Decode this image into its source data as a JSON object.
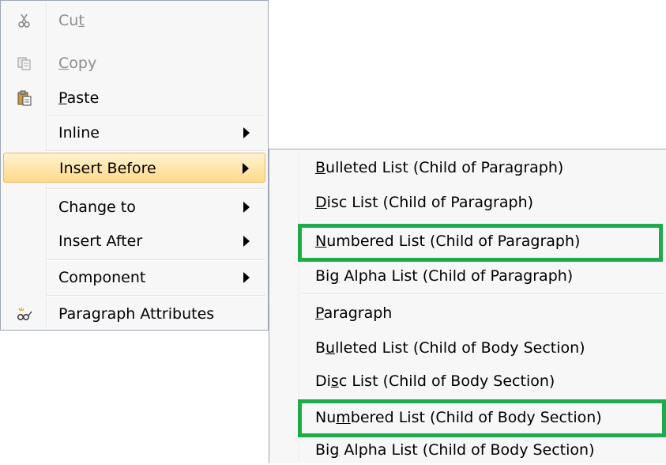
{
  "main_menu": {
    "items": [
      {
        "pre": "Cu",
        "acc": "t",
        "post": "",
        "icon": "scissors-icon"
      },
      {
        "pre": "",
        "acc": "C",
        "post": "opy",
        "icon": "copy-icon"
      },
      {
        "pre": "",
        "acc": "P",
        "post": "aste",
        "icon": "paste-icon"
      },
      {
        "label": "Inline"
      },
      {
        "label": "Insert Before"
      },
      {
        "label": "Change to"
      },
      {
        "label": "Insert After"
      },
      {
        "label": "Component"
      },
      {
        "label": "Paragraph Attributes",
        "icon": "attributes-icon"
      }
    ]
  },
  "sub_menu": {
    "items": [
      {
        "pre": "",
        "acc": "B",
        "post": "ulleted List (Child of Paragraph)"
      },
      {
        "pre": "",
        "acc": "D",
        "post": "isc List (Child of Paragraph)"
      },
      {
        "pre": "",
        "acc": "N",
        "post": "umbered List (Child of Paragraph)"
      },
      {
        "pre": "Bi",
        "acc": "g",
        "post": " Alpha List (Child of Paragraph)"
      },
      {
        "pre": "",
        "acc": "P",
        "post": "aragraph"
      },
      {
        "pre": "B",
        "acc": "u",
        "post": "lleted List (Child of Body Section)"
      },
      {
        "pre": "Di",
        "acc": "s",
        "post": "c List (Child of Body Section)"
      },
      {
        "pre": "Nu",
        "acc": "m",
        "post": "bered List (Child of Body Section)"
      },
      {
        "pre": "Bi",
        "acc": "g",
        "post": " Alpha List (Child of Body Section)"
      }
    ]
  },
  "colors": {
    "callout": "#1faa4b",
    "highlight": "#ffd98a"
  }
}
